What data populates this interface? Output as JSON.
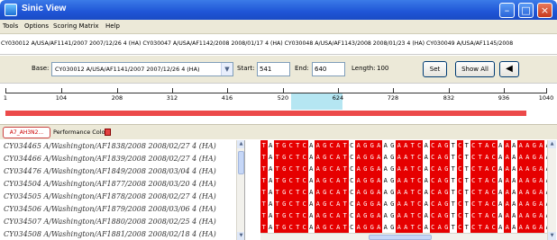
{
  "window": {
    "title": "Sinic View",
    "controls": [
      "minimize",
      "maximize",
      "close"
    ]
  },
  "menu": [
    "Tools",
    "Options",
    "Scoring Matrix",
    "Help"
  ],
  "sequence_header": "CY030012 A/USA/AF1141/2007 2007/12/26 4 (HA) CY030047 A/USA/AF1142/2008 2008/01/17 4 (HA) CY030048 A/USA/AF1143/2008 2008/01/23 4 (HA) CY030049 A/USA/AF1145/2008",
  "controls": {
    "base_label": "Base:",
    "base_value": "CY030012 A/USA/AF1141/2007 2007/12/26 4 (HA)",
    "start_label": "Start:",
    "start_value": "541",
    "end_label": "End:",
    "end_value": "640",
    "length_label": "Length:",
    "length_value": "100",
    "set_button": "Set",
    "show_all_button": "Show All",
    "back_arrow_icon": "left-triangle-icon"
  },
  "ruler": {
    "ticks": [
      "1",
      "104",
      "208",
      "312",
      "416",
      "520",
      "624",
      "728",
      "832",
      "936",
      "1040"
    ]
  },
  "panel": {
    "tab_label": "A7_AH3N2...",
    "performance_label": "Performance Color"
  },
  "rows": [
    "CY034465 A/Washington/AF1838/2008 2008/02/27 4 (HA)",
    "CY034466 A/Washington/AF1839/2008 2008/02/27 4 (HA)",
    "CY034476 A/Washington/AF1849/2008 2008/03/04 4 (HA)",
    "CY034504 A/Washington/AF1877/2008 2008/03/20 4 (HA)",
    "CY034505 A/Washington/AF1878/2008 2008/02/27 4 (HA)",
    "CY034506 A/Washington/AF1879/2008 2008/03/06 4 (HA)",
    "CY034507 A/Washington/AF1880/2008 2008/02/25 4 (HA)",
    "CY034508 A/Washington/AF1881/2008 2008/02/18 4 (HA)"
  ],
  "sequences": [
    "TATGCTCAAGCATCAGGAAGAATCACAGTCTCTACAAAAAGAAGCCAACAAAATGTAA",
    "TATGCTCAAGCATCAGGAAGAATCACAGTCTCTACAAAAAGAAGCCAACAAAATGTAA",
    "TATGCTCAAGCATCAGGAAGAATCACAGTCTCTACAAAAAGAAGCCAACAAAATGTAA",
    "TATGCTCAAGCATCAGGAAGAATCACAGTCTCTACAAAAAGAAGCCAACAAAATGTAA",
    "TATGCTCAAGCATCAGGAAGAATCACAGTCTCTACAAAAAGAAGCCAACAAAATGTAA",
    "TATGCTCAAGCATCAGGAAGAATCACAGTCTCTACAAAAAGAAGCCAACAAAATGTAA",
    "TATGCTCAAGCATCAGGAAGAATCACAGTCTCTACAAAAAGAAGCCAACAAAATGTAA",
    "TATGCTCAAGCATCAGGAAGAATCACAGTCTCTACAAAAAGAAGCCAACAAAATGTAA"
  ],
  "colors": {
    "match": "#e60000",
    "mismatch": "#ffffff",
    "title_bar": "#1f55d6",
    "ruler_highlight": "#b5e6f2"
  }
}
